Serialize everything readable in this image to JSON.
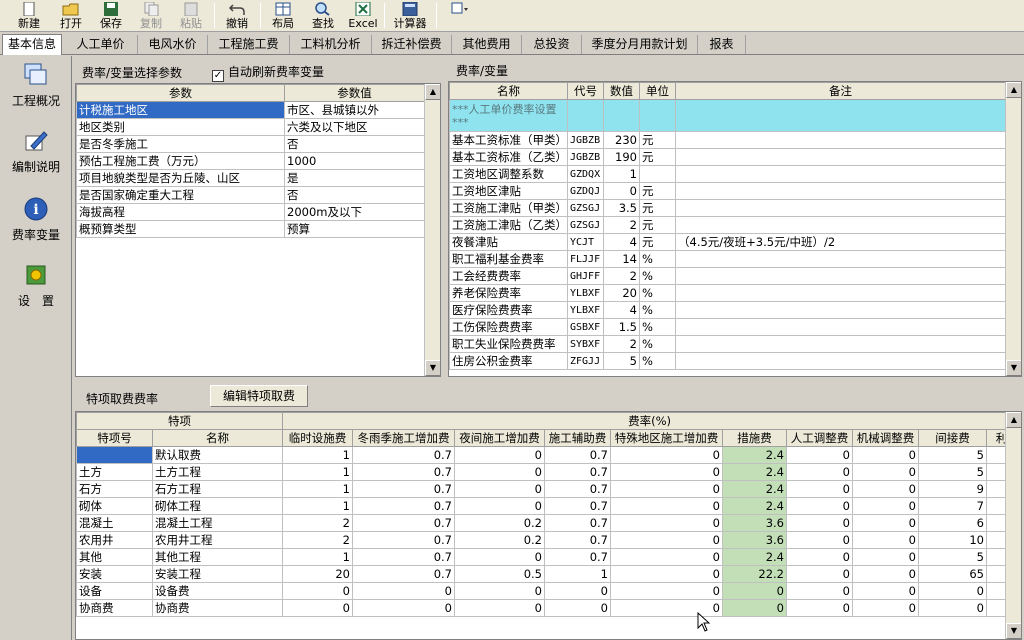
{
  "toolbar": {
    "new": "新建",
    "open": "打开",
    "save": "保存",
    "copy": "复制",
    "paste": "粘贴",
    "undo": "撤销",
    "layout": "布局",
    "find": "查找",
    "excel": "Excel",
    "calc": "计算器"
  },
  "tabs": [
    "基本信息",
    "人工单价",
    "电风水价",
    "工程施工费",
    "工料机分析",
    "拆迁补偿费",
    "其他费用",
    "总投资",
    "季度分月用款计划",
    "报表"
  ],
  "sidebar": [
    "工程概况",
    "编制说明",
    "费率变量",
    "设　置"
  ],
  "param_panel": {
    "title": "费率/变量选择参数",
    "auto_refresh": "自动刷新费率变量",
    "headers": [
      "参数",
      "参数值"
    ],
    "rows": [
      [
        "计税施工地区",
        "市区、县城镇以外"
      ],
      [
        "地区类别",
        "六类及以下地区"
      ],
      [
        "是否冬季施工",
        "否"
      ],
      [
        "预估工程施工费（万元）",
        "1000"
      ],
      [
        "项目地貌类型是否为丘陵、山区",
        "是"
      ],
      [
        "是否国家确定重大工程",
        "否"
      ],
      [
        "海拔高程",
        "2000m及以下"
      ],
      [
        "概预算类型",
        "预算"
      ]
    ]
  },
  "rate_panel": {
    "title": "费率/变量",
    "headers": [
      "名称",
      "代号",
      "数值",
      "单位",
      "备注"
    ],
    "first_row": "***人工单价费率设置***",
    "rows": [
      [
        "基本工资标准（甲类）",
        "JGBZB",
        "230",
        "元",
        ""
      ],
      [
        "基本工资标准（乙类）",
        "JGBZB",
        "190",
        "元",
        ""
      ],
      [
        "工资地区调整系数",
        "GZDQX",
        "1",
        "",
        ""
      ],
      [
        "工资地区津贴",
        "GZDQJ",
        "0",
        "元",
        ""
      ],
      [
        "工资施工津贴（甲类）",
        "GZSGJ",
        "3.5",
        "元",
        ""
      ],
      [
        "工资施工津贴（乙类）",
        "GZSGJ",
        "2",
        "元",
        ""
      ],
      [
        "夜餐津贴",
        "YCJT",
        "4",
        "元",
        "（4.5元/夜班+3.5元/中班）/2"
      ],
      [
        "职工福利基金费率",
        "FLJJF",
        "14",
        "%",
        ""
      ],
      [
        "工会经费费率",
        "GHJFF",
        "2",
        "%",
        ""
      ],
      [
        "养老保险费率",
        "YLBXF",
        "20",
        "%",
        ""
      ],
      [
        "医疗保险费费率",
        "YLBXF",
        "4",
        "%",
        ""
      ],
      [
        "工伤保险费费率",
        "GSBXF",
        "1.5",
        "%",
        ""
      ],
      [
        "职工失业保险费费率",
        "SYBXF",
        "2",
        "%",
        ""
      ],
      [
        "住房公积金费率",
        "ZFGJJ",
        "5",
        "%",
        ""
      ]
    ]
  },
  "special_panel": {
    "title": "特项取费费率",
    "edit_button": "编辑特项取费",
    "group_headers": [
      "特项",
      "费率(%)"
    ],
    "headers": [
      "特项号",
      "名称",
      "临时设施费",
      "冬雨季施工增加费",
      "夜间施工增加费",
      "施工辅助费",
      "特殊地区施工增加费",
      "措施费",
      "人工调整费",
      "机械调整费",
      "间接费",
      "利"
    ],
    "rows": [
      [
        "",
        "默认取费",
        "1",
        "0.7",
        "0",
        "0.7",
        "0",
        "2.4",
        "0",
        "0",
        "5"
      ],
      [
        "土方",
        "土方工程",
        "1",
        "0.7",
        "0",
        "0.7",
        "0",
        "2.4",
        "0",
        "0",
        "5"
      ],
      [
        "石方",
        "石方工程",
        "1",
        "0.7",
        "0",
        "0.7",
        "0",
        "2.4",
        "0",
        "0",
        "9"
      ],
      [
        "砌体",
        "砌体工程",
        "1",
        "0.7",
        "0",
        "0.7",
        "0",
        "2.4",
        "0",
        "0",
        "7"
      ],
      [
        "混凝土",
        "混凝土工程",
        "2",
        "0.7",
        "0.2",
        "0.7",
        "0",
        "3.6",
        "0",
        "0",
        "6"
      ],
      [
        "农用井",
        "农用井工程",
        "2",
        "0.7",
        "0.2",
        "0.7",
        "0",
        "3.6",
        "0",
        "0",
        "10"
      ],
      [
        "其他",
        "其他工程",
        "1",
        "0.7",
        "0",
        "0.7",
        "0",
        "2.4",
        "0",
        "0",
        "5"
      ],
      [
        "安装",
        "安装工程",
        "20",
        "0.7",
        "0.5",
        "1",
        "0",
        "22.2",
        "0",
        "0",
        "65"
      ],
      [
        "设备",
        "设备费",
        "0",
        "0",
        "0",
        "0",
        "0",
        "0",
        "0",
        "0",
        "0"
      ],
      [
        "协商费",
        "协商费",
        "0",
        "0",
        "0",
        "0",
        "0",
        "0",
        "0",
        "0",
        "0"
      ]
    ]
  }
}
